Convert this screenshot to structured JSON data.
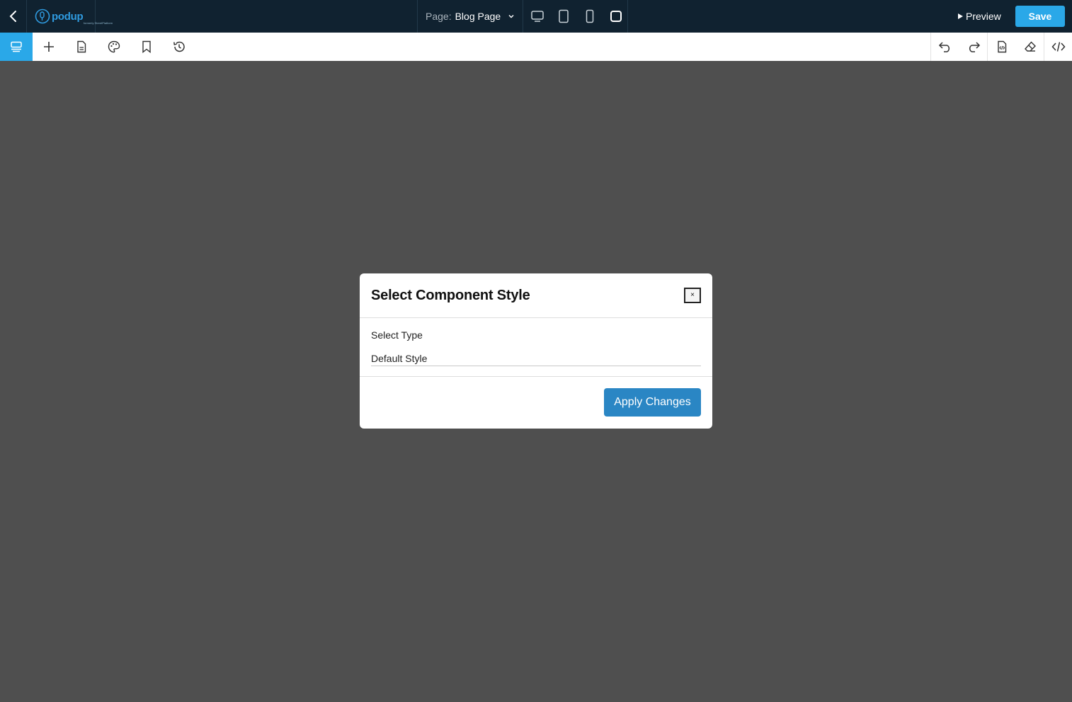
{
  "topbar": {
    "back_icon": "chevron-left-icon",
    "logo": {
      "text": "podup",
      "subtext": "formerly StreetPlatform"
    },
    "page_label": "Page:",
    "page_value": "Blog Page",
    "device_icons": [
      "desktop-icon",
      "tablet-icon",
      "mobile-icon",
      "fullscreen-icon"
    ],
    "preview_label": "Preview",
    "save_label": "Save"
  },
  "toolbar": {
    "left_tools": [
      "layers-icon",
      "plus-icon",
      "page-icon",
      "palette-icon",
      "bookmark-icon",
      "history-icon"
    ],
    "right_tools": [
      "undo-icon",
      "redo-icon",
      "code-file-icon",
      "eraser-icon",
      "code-icon"
    ]
  },
  "modal": {
    "title": "Select Component Style",
    "close_label": "×",
    "field_label": "Select Type",
    "field_value": "Default Style",
    "apply_label": "Apply Changes"
  },
  "colors": {
    "topbar_bg": "#102230",
    "accent": "#2aa8e8",
    "canvas_bg": "#4f4f4f",
    "apply_button": "#2a86c4"
  }
}
